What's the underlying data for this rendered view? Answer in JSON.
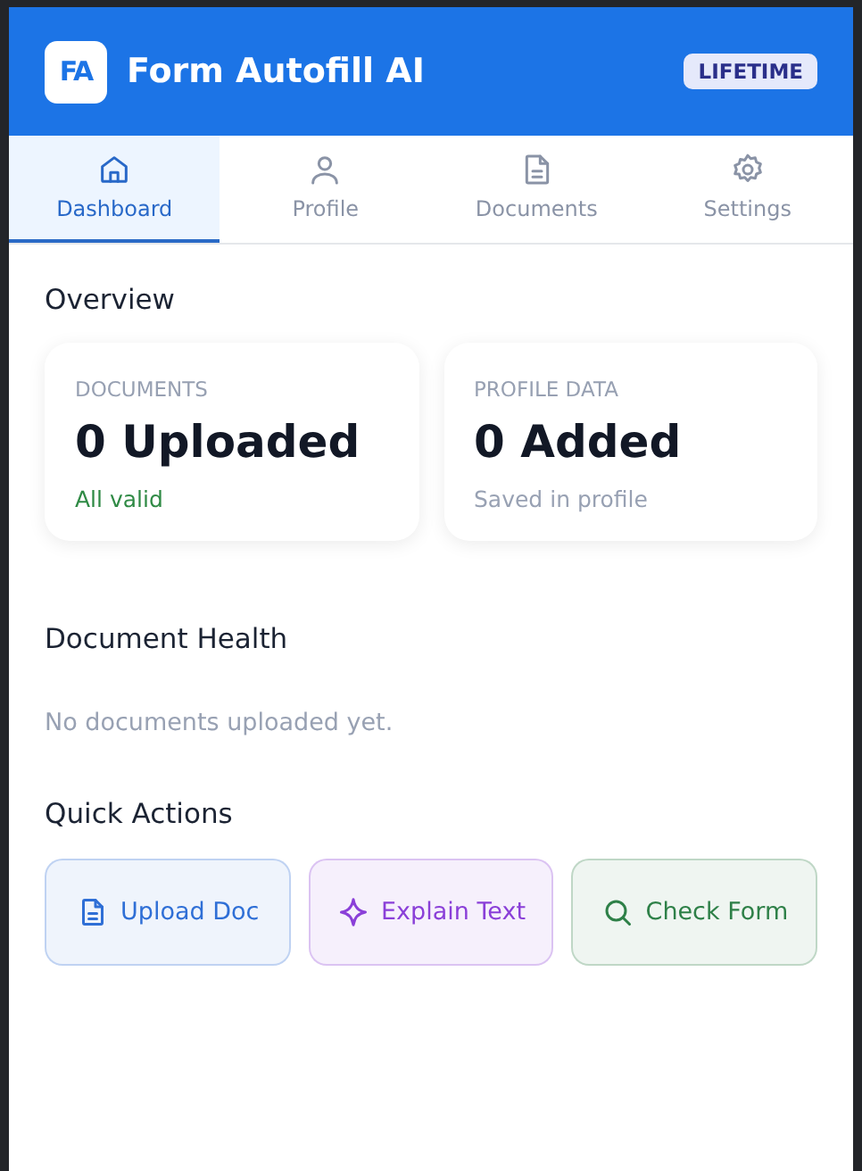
{
  "header": {
    "logo": "FA",
    "title": "Form Autofill AI",
    "badge": "LIFETIME"
  },
  "tabs": [
    {
      "label": "Dashboard",
      "selected": true
    },
    {
      "label": "Profile",
      "selected": false
    },
    {
      "label": "Documents",
      "selected": false
    },
    {
      "label": "Settings",
      "selected": false
    }
  ],
  "overview": {
    "title": "Overview",
    "cards": [
      {
        "label": "DOCUMENTS",
        "value": "0 Uploaded",
        "note": "All valid",
        "kind": "ok"
      },
      {
        "label": "PROFILE DATA",
        "value": "0 Added",
        "note": "Saved in profile",
        "kind": "muted"
      }
    ]
  },
  "health": {
    "title": "Document Health",
    "empty": "No documents uploaded yet."
  },
  "quick_actions": {
    "title": "Quick Actions",
    "actions": [
      {
        "label": "Upload Doc",
        "color": "#2f6fd6"
      },
      {
        "label": "Explain Text",
        "color": "#8a3fd8"
      },
      {
        "label": "Check Form",
        "color": "#2e8048"
      }
    ]
  }
}
